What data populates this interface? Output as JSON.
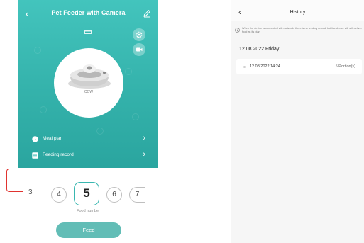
{
  "feeder_screen": {
    "title": "Pet Feeder with Camera",
    "back_icon": "chevron-left-icon",
    "edit_icon": "pencil-icon",
    "status_icon": "wifi-icon",
    "settings_icon": "gear-icon",
    "camera_icon": "camera-icon",
    "device_label": "COW",
    "menu": [
      {
        "label": "Meal plan",
        "icon": "clock-icon"
      },
      {
        "label": "Feeding record",
        "icon": "list-icon"
      }
    ],
    "picker": {
      "values": [
        "3",
        "4",
        "5",
        "6",
        "7"
      ],
      "selected": "5",
      "label": "Food number"
    },
    "feed_button": "Feed",
    "colors": {
      "teal": "#36b6af",
      "button": "#62bdb6",
      "highlight": "#e0332f"
    }
  },
  "history_screen": {
    "title": "History",
    "back_icon": "chevron-left-icon",
    "notice_icon": "info-icon",
    "notice": "When the device is connected with network, there is no feeding record, but the device will still deliver food as its plan",
    "date_heading": "12.08.2022 Friday",
    "records": [
      {
        "time": "12.08.2022 14:24",
        "portion": "5 Portion(s)"
      }
    ]
  }
}
